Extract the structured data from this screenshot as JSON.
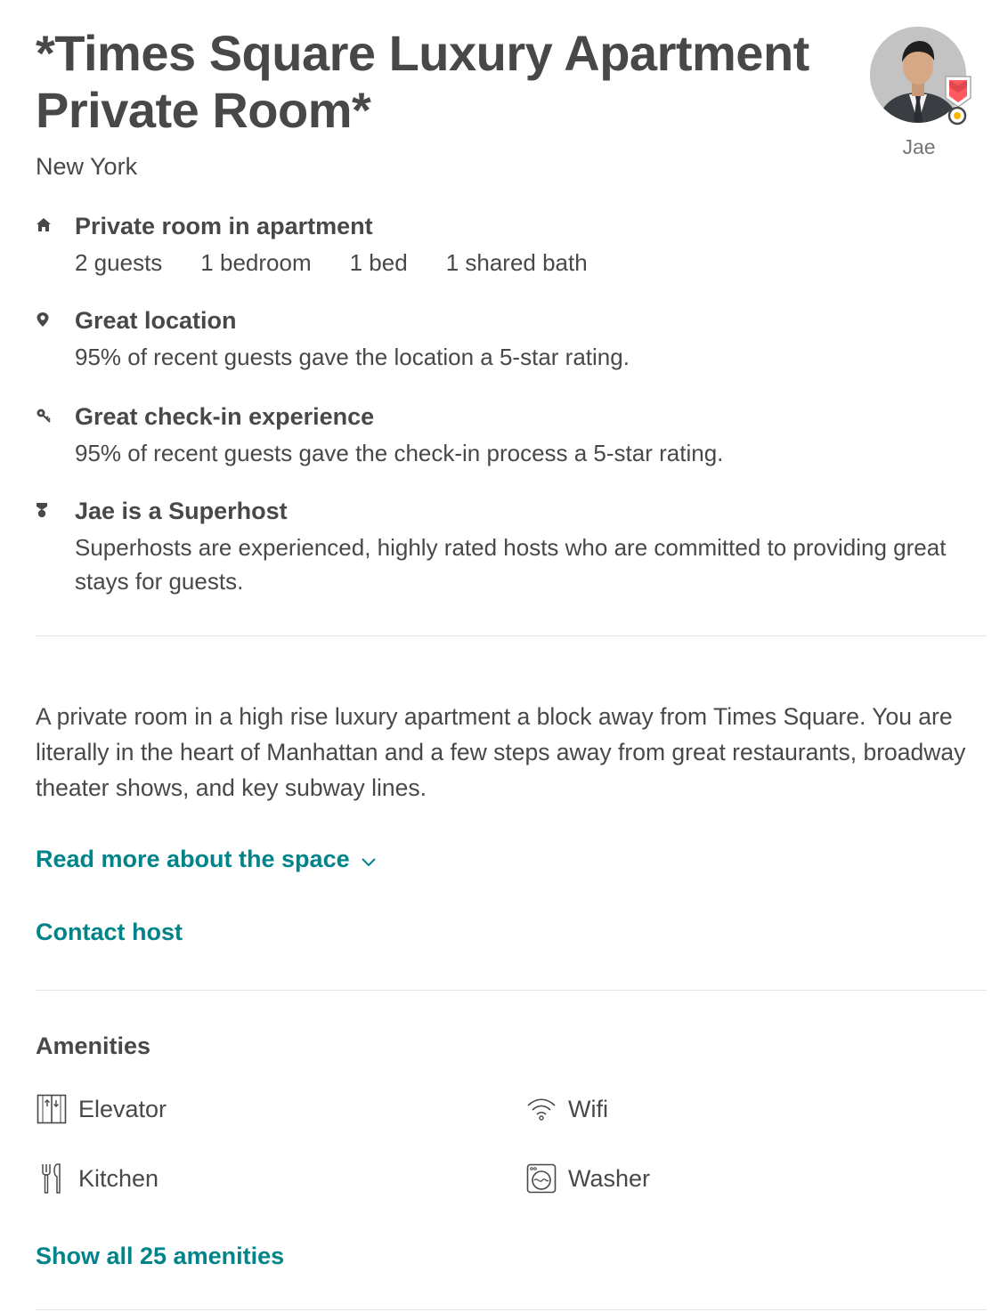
{
  "listing": {
    "title": "*Times Square Luxury Apartment Private Room*",
    "location": "New York"
  },
  "host": {
    "name": "Jae",
    "avatar_icon": "host-avatar-photo",
    "badge_icon": "superhost-badge-icon"
  },
  "highlights": [
    {
      "icon": "home-icon",
      "title": "Private room in apartment",
      "specs": [
        "2 guests",
        "1 bedroom",
        "1 bed",
        "1 shared bath"
      ]
    },
    {
      "icon": "map-pin-icon",
      "title": "Great location",
      "description": "95% of recent guests gave the location a 5-star rating."
    },
    {
      "icon": "key-icon",
      "title": "Great check-in experience",
      "description": "95% of recent guests gave the check-in process a 5-star rating."
    },
    {
      "icon": "superhost-medal-icon",
      "title": "Jae is a Superhost",
      "description": "Superhosts are experienced, highly rated hosts who are committed to providing great stays for guests."
    }
  ],
  "description": "A private room in a high rise luxury apartment a block away from Times Square. You are literally in the heart of Manhattan and a few steps away from great restaurants, broadway theater shows, and key subway lines.",
  "links": {
    "read_more": "Read more about the space",
    "contact_host": "Contact host",
    "show_all_amenities": "Show all 25 amenities"
  },
  "amenities": {
    "heading": "Amenities",
    "items": [
      {
        "label": "Elevator",
        "icon": "elevator-icon"
      },
      {
        "label": "Wifi",
        "icon": "wifi-icon"
      },
      {
        "label": "Kitchen",
        "icon": "kitchen-icon"
      },
      {
        "label": "Washer",
        "icon": "washer-icon"
      }
    ]
  },
  "colors": {
    "text": "#484848",
    "muted": "#767676",
    "link": "#008489",
    "divider": "#e4e4e4",
    "badge": "#ff5a5f"
  }
}
